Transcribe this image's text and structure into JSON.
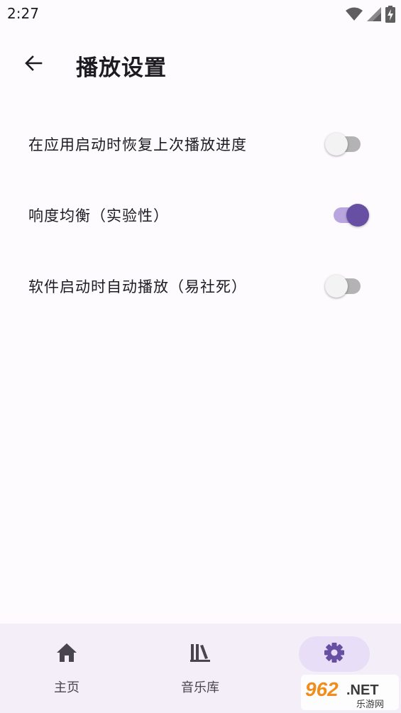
{
  "status_bar": {
    "time": "2:27"
  },
  "app_bar": {
    "title": "播放设置"
  },
  "settings": [
    {
      "label": "在应用启动时恢复上次播放进度",
      "enabled": false
    },
    {
      "label": "响度均衡（实验性）",
      "enabled": true
    },
    {
      "label": "软件启动时自动播放（易社死）",
      "enabled": false
    }
  ],
  "bottom_nav": {
    "items": [
      {
        "label": "主页",
        "icon": "home-icon",
        "active": false
      },
      {
        "label": "音乐库",
        "icon": "library-icon",
        "active": false
      },
      {
        "label": "",
        "icon": "gear-icon",
        "active": true
      }
    ]
  },
  "watermark": {
    "brand": "962.NET",
    "subtitle": "乐游网"
  },
  "colors": {
    "accent": "#6750a4",
    "accent_track": "#b9a6e0",
    "nav_bg": "#f4eef8",
    "nav_pill": "#e8def8",
    "background": "#fefbff"
  }
}
